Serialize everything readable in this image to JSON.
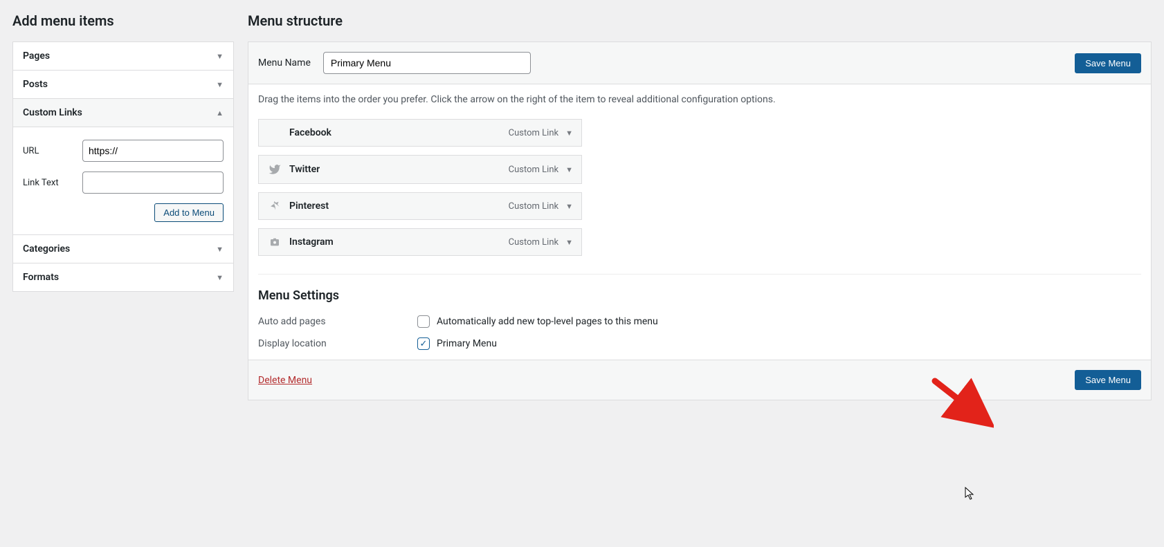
{
  "left": {
    "title": "Add menu items",
    "sections": [
      {
        "label": "Pages",
        "open": false
      },
      {
        "label": "Posts",
        "open": false
      },
      {
        "label": "Custom Links",
        "open": true
      },
      {
        "label": "Categories",
        "open": false
      },
      {
        "label": "Formats",
        "open": false
      }
    ],
    "custom_links": {
      "url_label": "URL",
      "url_value": "https://",
      "text_label": "Link Text",
      "text_value": "",
      "add_button": "Add to Menu"
    }
  },
  "right": {
    "title": "Menu structure",
    "menu_name_label": "Menu Name",
    "menu_name_value": "Primary Menu",
    "save_button": "Save Menu",
    "instructions": "Drag the items into the order you prefer. Click the arrow on the right of the item to reveal additional configuration options.",
    "items": [
      {
        "label": "Facebook",
        "type": "Custom Link",
        "icon": ""
      },
      {
        "label": "Twitter",
        "type": "Custom Link",
        "icon": "twitter"
      },
      {
        "label": "Pinterest",
        "type": "Custom Link",
        "icon": "pin"
      },
      {
        "label": "Instagram",
        "type": "Custom Link",
        "icon": "camera"
      }
    ],
    "settings": {
      "heading": "Menu Settings",
      "auto_add_label": "Auto add pages",
      "auto_add_text": "Automatically add new top-level pages to this menu",
      "auto_add_checked": false,
      "display_loc_label": "Display location",
      "display_loc_text": "Primary Menu",
      "display_loc_checked": true
    },
    "footer": {
      "delete": "Delete Menu",
      "save": "Save Menu"
    }
  }
}
